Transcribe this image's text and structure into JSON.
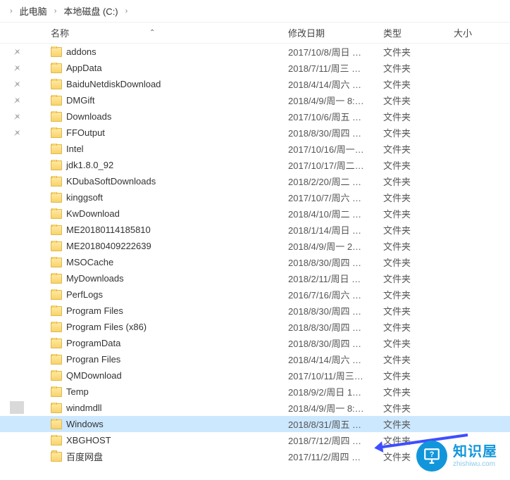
{
  "breadcrumb": {
    "items": [
      "此电脑",
      "本地磁盘 (C:)"
    ]
  },
  "columns": {
    "name": "名称",
    "date": "修改日期",
    "type": "类型",
    "size": "大小"
  },
  "files": [
    {
      "pinned": true,
      "name": "addons",
      "date": "2017/10/8/周日 …",
      "type": "文件夹",
      "selected": false
    },
    {
      "pinned": true,
      "name": "AppData",
      "date": "2018/7/11/周三 …",
      "type": "文件夹",
      "selected": false
    },
    {
      "pinned": true,
      "name": "BaiduNetdiskDownload",
      "date": "2018/4/14/周六 …",
      "type": "文件夹",
      "selected": false
    },
    {
      "pinned": true,
      "name": "DMGift",
      "date": "2018/4/9/周一  8:…",
      "type": "文件夹",
      "selected": false
    },
    {
      "pinned": true,
      "name": "Downloads",
      "date": "2017/10/6/周五 …",
      "type": "文件夹",
      "selected": false
    },
    {
      "pinned": true,
      "name": "FFOutput",
      "date": "2018/8/30/周四 …",
      "type": "文件夹",
      "selected": false
    },
    {
      "pinned": false,
      "name": "Intel",
      "date": "2017/10/16/周一…",
      "type": "文件夹",
      "selected": false
    },
    {
      "pinned": false,
      "name": "jdk1.8.0_92",
      "date": "2017/10/17/周二…",
      "type": "文件夹",
      "selected": false
    },
    {
      "pinned": false,
      "name": "KDubaSoftDownloads",
      "date": "2018/2/20/周二 …",
      "type": "文件夹",
      "selected": false
    },
    {
      "pinned": false,
      "name": "kinggsoft",
      "date": "2017/10/7/周六 …",
      "type": "文件夹",
      "selected": false
    },
    {
      "pinned": false,
      "name": "KwDownload",
      "date": "2018/4/10/周二 …",
      "type": "文件夹",
      "selected": false
    },
    {
      "pinned": false,
      "name": "ME20180114185810",
      "date": "2018/1/14/周日 …",
      "type": "文件夹",
      "selected": false
    },
    {
      "pinned": false,
      "name": "ME20180409222639",
      "date": "2018/4/9/周一  2…",
      "type": "文件夹",
      "selected": false
    },
    {
      "pinned": false,
      "name": "MSOCache",
      "date": "2018/8/30/周四 …",
      "type": "文件夹",
      "selected": false
    },
    {
      "pinned": false,
      "name": "MyDownloads",
      "date": "2018/2/11/周日 …",
      "type": "文件夹",
      "selected": false
    },
    {
      "pinned": false,
      "name": "PerfLogs",
      "date": "2016/7/16/周六 …",
      "type": "文件夹",
      "selected": false
    },
    {
      "pinned": false,
      "name": "Program Files",
      "date": "2018/8/30/周四 …",
      "type": "文件夹",
      "selected": false
    },
    {
      "pinned": false,
      "name": "Program Files (x86)",
      "date": "2018/8/30/周四 …",
      "type": "文件夹",
      "selected": false
    },
    {
      "pinned": false,
      "name": "ProgramData",
      "date": "2018/8/30/周四 …",
      "type": "文件夹",
      "selected": false
    },
    {
      "pinned": false,
      "name": "Progran Files",
      "date": "2018/4/14/周六 …",
      "type": "文件夹",
      "selected": false
    },
    {
      "pinned": false,
      "name": "QMDownload",
      "date": "2017/10/11/周三…",
      "type": "文件夹",
      "selected": false
    },
    {
      "pinned": false,
      "name": "Temp",
      "date": "2018/9/2/周日  1…",
      "type": "文件夹",
      "selected": false
    },
    {
      "pinned": false,
      "name": "windmdll",
      "date": "2018/4/9/周一  8:…",
      "type": "文件夹",
      "selected": false
    },
    {
      "pinned": false,
      "name": "Windows",
      "date": "2018/8/31/周五 …",
      "type": "文件夹",
      "selected": true
    },
    {
      "pinned": false,
      "name": "XBGHOST",
      "date": "2018/7/12/周四 …",
      "type": "文件夹",
      "selected": false
    },
    {
      "pinned": false,
      "name": "百度网盘",
      "date": "2017/11/2/周四 …",
      "type": "文件夹",
      "selected": false
    }
  ],
  "watermark": {
    "cn": "知识屋",
    "en": "zhishiwu.com",
    "icon": "?"
  }
}
